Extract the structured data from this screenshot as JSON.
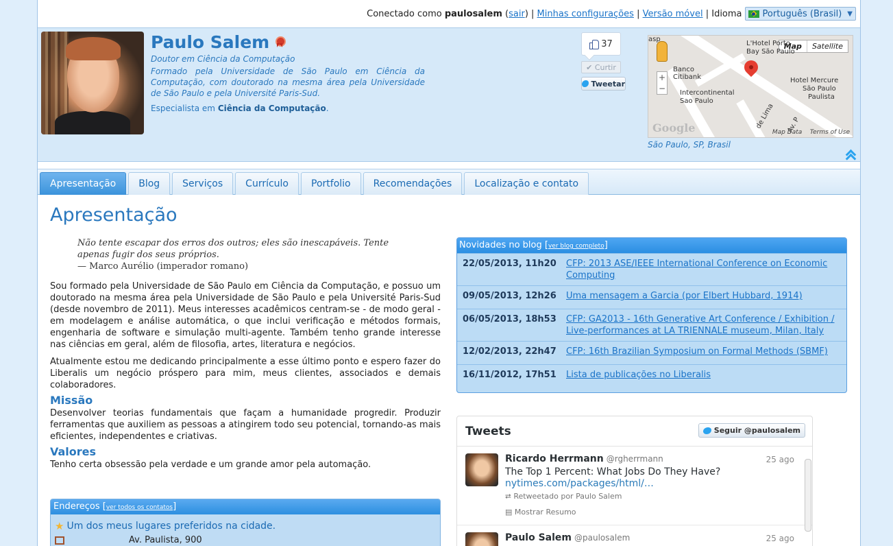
{
  "topbar": {
    "connected_prefix": "Conectado como",
    "username": "paulosalem",
    "logout": "sair",
    "settings": "Minhas configurações",
    "mobile": "Versão móvel",
    "language_label": "Idioma",
    "language_value": "Português (Brasil)"
  },
  "profile": {
    "name": "Paulo Salem",
    "title": "Doutor em Ciência da Computação",
    "bio": "Formado pela Universidade de São Paulo em Ciência da Computação, com doutorado na mesma área pela Universidade de São Paulo e pela Université Paris-Sud.",
    "specialist_prefix": "Especialista em",
    "specialist_area": "Ciência da Computação",
    "like_count": "37",
    "like_button": "Curtir",
    "tweet_button": "Tweetar"
  },
  "map": {
    "map_label": "Map",
    "satellite_label": "Satellite",
    "caption": "São Paulo, SP, Brasil",
    "labels": [
      "L'Hotel Porto",
      "Bay São Paulo",
      "Banco",
      "Citibank",
      "Intercontinental",
      "Sao Paulo",
      "Hotel Mercure",
      "São Paulo",
      "Paulista",
      "de Lima",
      "Av. P",
      "asp"
    ],
    "attribution_data": "Map Data",
    "attribution_terms": "Terms of Use",
    "google": "Google"
  },
  "tabs": [
    "Apresentação",
    "Blog",
    "Serviços",
    "Currículo",
    "Portfolio",
    "Recomendações",
    "Localização e contato"
  ],
  "main": {
    "title": "Apresentação",
    "quote_text": "Não tente escapar dos erros dos outros; eles são inescapáveis. Tente apenas fugir dos seus próprios.",
    "quote_author": "— Marco Aurélio (imperador romano)",
    "para1": "Sou formado pela Universidade de São Paulo em Ciência da Computação, e possuo um doutorado na mesma área pela Universidade de São Paulo e pela Université Paris-Sud (desde novembro de 2011). Meus interesses acadêmicos centram-se - de modo geral - em modelagem e análise automática, o que inclui verificação e métodos formais, engenharia de software e simulação multi-agente. Também tenho grande interesse nas ciências em geral, além de filosofia, artes, literatura e negócios.",
    "para2": "Atualmente estou me dedicando principalmente a esse último ponto e espero fazer do Liberalis um negócio próspero para mim, meus clientes, associados e demais colaboradores.",
    "mission_title": "Missão",
    "mission_text": "Desenvolver teorias fundamentais que façam a humanidade progredir. Produzir ferramentas que auxiliem as pessoas a atingirem todo seu potencial, tornando-as mais eficientes, independentes e criativas.",
    "values_title": "Valores",
    "values_text": "Tenho certa obsessão pela verdade e um grande amor pela automação."
  },
  "addresses": {
    "title": "Endereços",
    "link": "ver todos os contatos",
    "favorite": "Um dos meus lugares preferidos na cidade.",
    "street": "Av. Paulista, 900"
  },
  "blog": {
    "title": "Novidades no blog",
    "link": "ver blog completo",
    "posts": [
      {
        "date": "22/05/2013, 11h20",
        "title": "CFP: 2013 ASE/IEEE International Conference on Economic Computing"
      },
      {
        "date": "09/05/2013, 12h26",
        "title": "Uma mensagem a Garcia (por Elbert Hubbard, 1914)"
      },
      {
        "date": "06/05/2013, 18h53",
        "title": "CFP: GA2013 - 16th Generative Art Conference / Exhibition / Live-performances at LA TRIENNALE museum, Milan, Italy"
      },
      {
        "date": "12/02/2013, 22h47",
        "title": "CFP: 16th Brazilian Symposium on Formal Methods (SBMF)"
      },
      {
        "date": "16/11/2012, 17h51",
        "title": "Lista de publicações no Liberalis"
      }
    ]
  },
  "tweets": {
    "title": "Tweets",
    "follow": "Seguir @paulosalem",
    "items": [
      {
        "name": "Ricardo Herrmann",
        "handle": "@rgherrmann",
        "time": "25 ago",
        "text": "The Top 1 Percent: What Jobs Do They Have?",
        "url": "nytimes.com/packages/html/…",
        "retweet": "Retweetado por Paulo Salem",
        "summary": "Mostrar Resumo"
      },
      {
        "name": "Paulo Salem",
        "handle": "@paulosalem",
        "time": "25 ago"
      }
    ]
  }
}
